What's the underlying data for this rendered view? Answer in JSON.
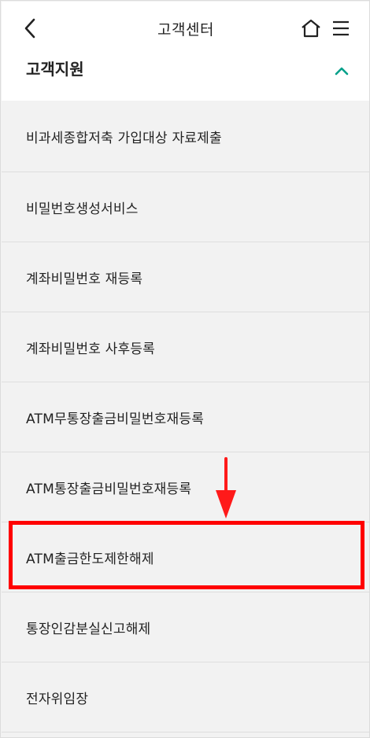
{
  "header": {
    "title": "고객센터",
    "back_icon": "chevron-left-icon",
    "home_icon": "home-icon",
    "menu_icon": "hamburger-menu-icon"
  },
  "section": {
    "title": "고객지원",
    "toggle_icon": "chevron-up-icon",
    "accent_color": "#00a08a"
  },
  "menu_items": [
    {
      "label": "비과세종합저축 가입대상 자료제출"
    },
    {
      "label": "비밀번호생성서비스"
    },
    {
      "label": "계좌비밀번호 재등록"
    },
    {
      "label": "계좌비밀번호 사후등록"
    },
    {
      "label": "ATM무통장출금비밀번호재등록"
    },
    {
      "label": "ATM통장출금비밀번호재등록"
    },
    {
      "label": "ATM출금한도제한해제"
    },
    {
      "label": "통장인감분실신고해제"
    },
    {
      "label": "전자위임장"
    }
  ],
  "annotation": {
    "highlight_color": "#ff0000",
    "highlighted_item": "ATM출금한도제한해제"
  }
}
